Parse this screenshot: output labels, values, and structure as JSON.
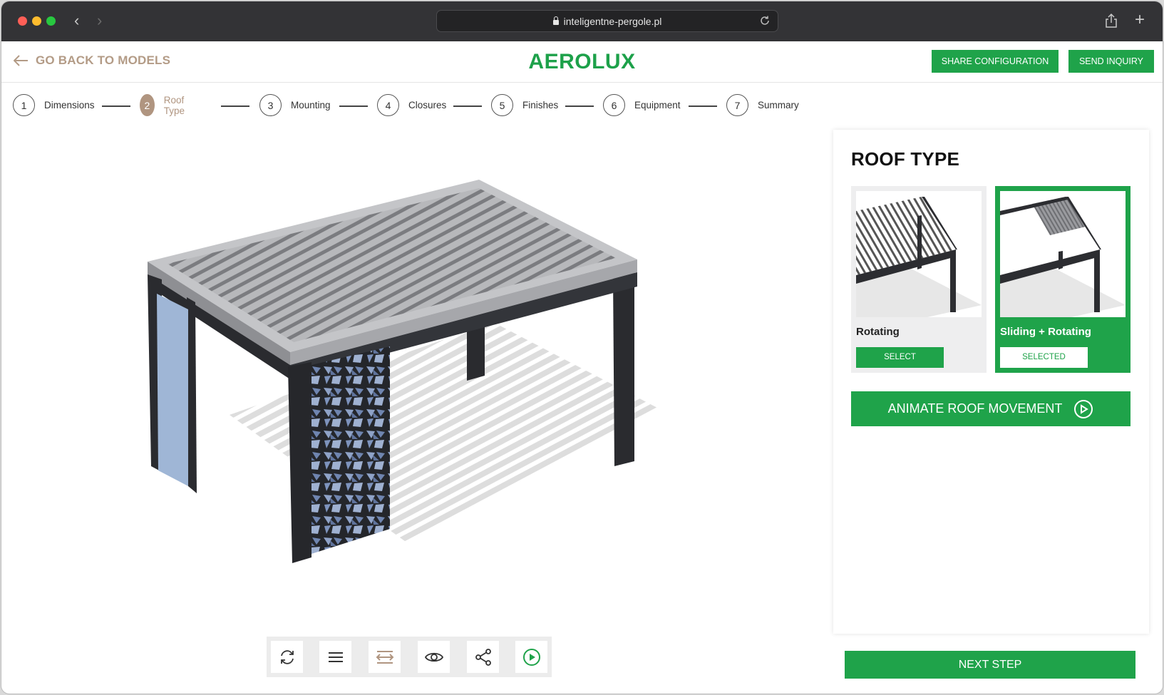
{
  "browser": {
    "url": "inteligentne-pergole.pl"
  },
  "header": {
    "back_label": "GO BACK TO MODELS",
    "brand": "AEROLUX",
    "share_label": "SHARE CONFIGURATION",
    "inquiry_label": "SEND INQUIRY"
  },
  "steps": [
    {
      "num": "1",
      "label": "Dimensions"
    },
    {
      "num": "2",
      "label": "Roof Type",
      "active": true
    },
    {
      "num": "3",
      "label": "Mounting"
    },
    {
      "num": "4",
      "label": "Closures"
    },
    {
      "num": "5",
      "label": "Finishes"
    },
    {
      "num": "6",
      "label": "Equipment"
    },
    {
      "num": "7",
      "label": "Summary"
    }
  ],
  "toolbar": {
    "icons": [
      "rotate-icon",
      "menu-icon",
      "width-arrows-icon",
      "eye-icon",
      "share-icon",
      "play-icon"
    ]
  },
  "panel": {
    "title": "ROOF TYPE",
    "options": [
      {
        "name": "Rotating",
        "button": "SELECT",
        "selected": false
      },
      {
        "name": "Sliding + Rotating",
        "button": "SELECTED",
        "selected": true
      }
    ],
    "animate_label": "ANIMATE ROOF MOVEMENT"
  },
  "footer": {
    "next_label": "NEXT STEP"
  },
  "colors": {
    "accent_green": "#1fa34a",
    "accent_tan": "#b09580"
  }
}
